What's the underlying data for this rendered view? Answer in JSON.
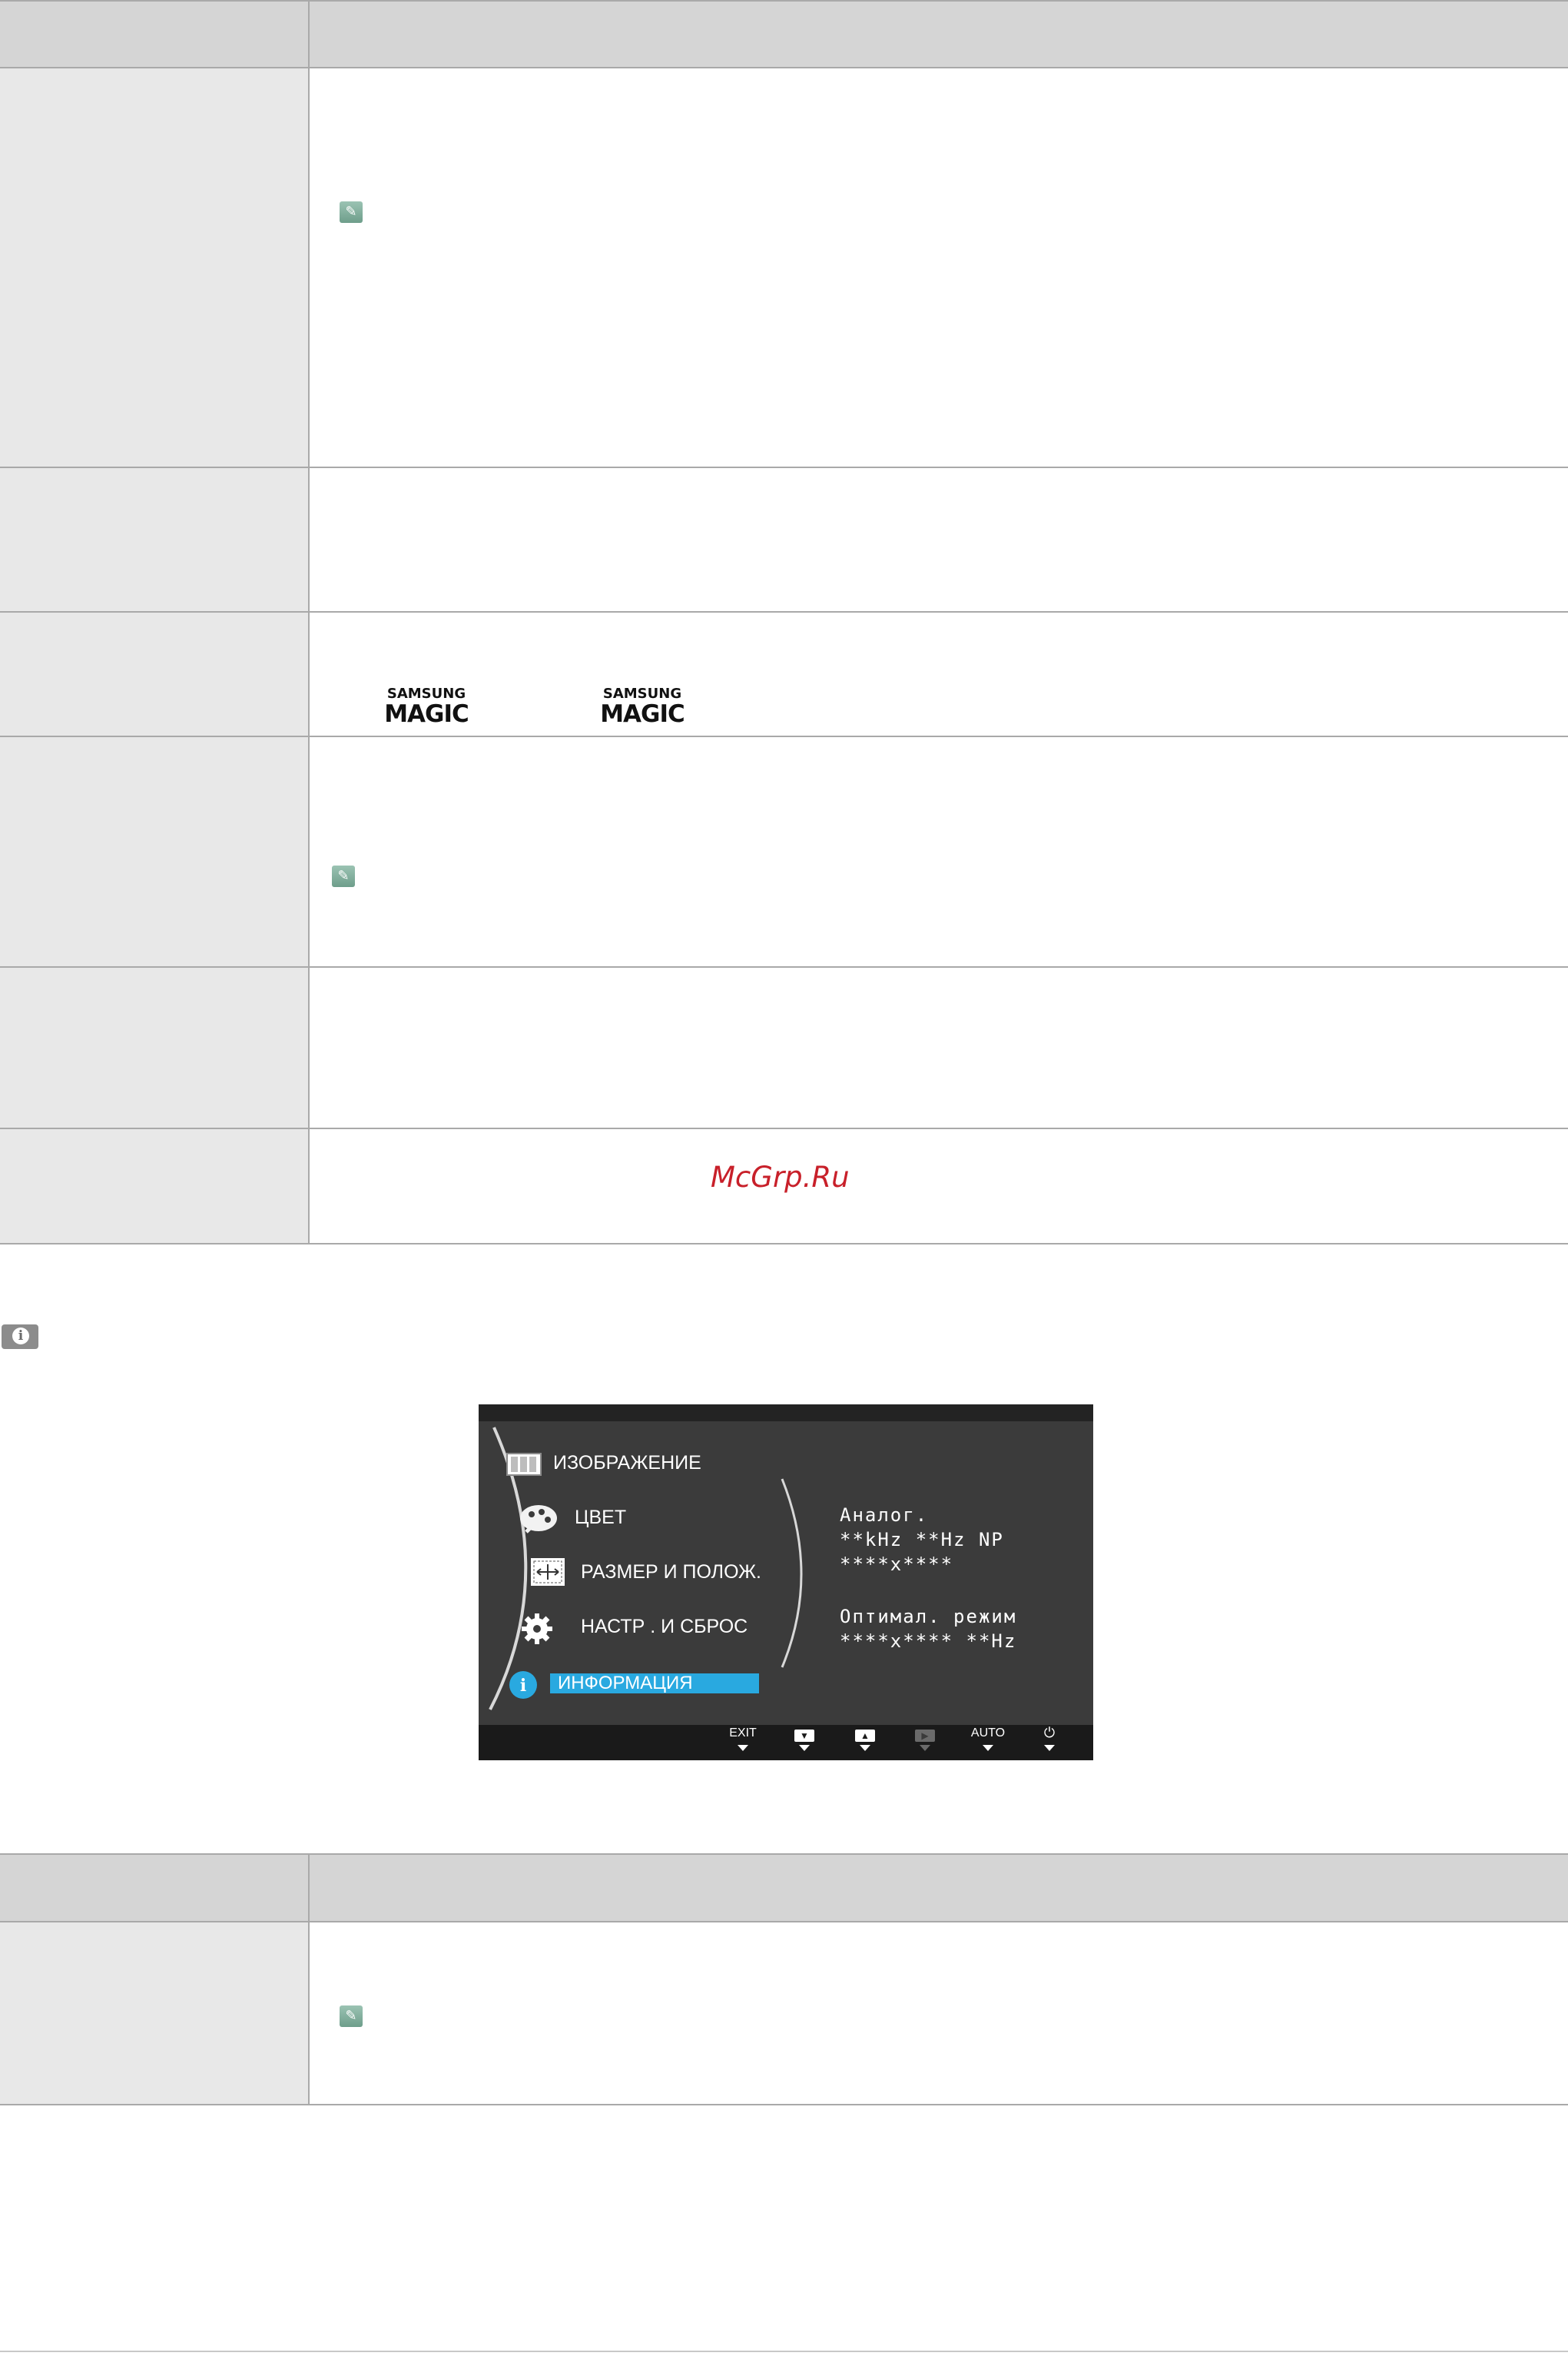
{
  "osd": {
    "menu": [
      {
        "label": "ИЗОБРАЖЕНИЕ",
        "icon": "picture-icon"
      },
      {
        "label": "ЦВЕТ",
        "icon": "palette-icon"
      },
      {
        "label": "РАЗМЕР И ПОЛОЖ.",
        "icon": "size-position-icon"
      },
      {
        "label": "НАСТР . И СБРОС",
        "icon": "gear-icon"
      },
      {
        "label": "ИНФОРМАЦИЯ",
        "icon": "info-icon"
      }
    ],
    "info_lines": [
      "Аналог.",
      "**kHz **Hz NP",
      "****x****",
      "Оптимал. режим",
      "****x****  **Hz"
    ],
    "buttons": [
      "EXIT",
      "▼",
      "▲",
      "▶",
      "AUTO",
      "⏻"
    ],
    "highlight_color": "#29a9e0"
  },
  "logos": {
    "samsung_top": "SAMSUNG",
    "magic": "MAGIC"
  },
  "watermark": "McGrp.Ru"
}
